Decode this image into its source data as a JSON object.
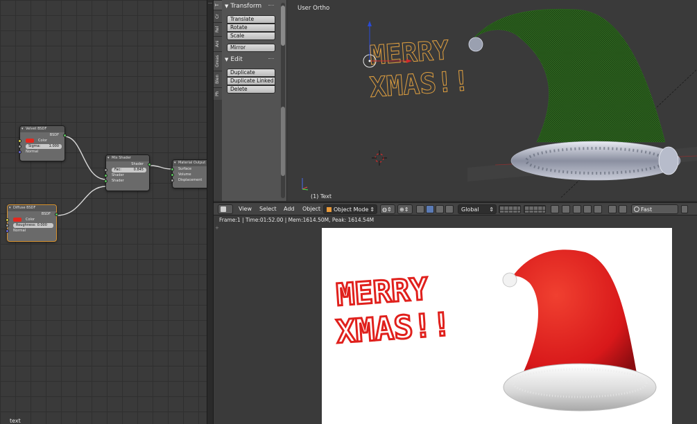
{
  "node_editor": {
    "status_text": "text",
    "nodes": {
      "velvet": {
        "title": "Velvet BSDF",
        "output": "BSDF",
        "color_label": "Color",
        "sigma_label": "Sigma:",
        "sigma_value": "1.000",
        "normal_label": "Normal"
      },
      "diffuse": {
        "title": "Diffuse BSDF",
        "output": "BSDF",
        "color_label": "Color",
        "roughness_label": "Roughness:",
        "roughness_value": "0.000",
        "normal_label": "Normal"
      },
      "mix": {
        "title": "Mix Shader",
        "output": "Shader",
        "fac_label": "Fac:",
        "fac_value": "0.845",
        "shader1": "Shader",
        "shader2": "Shader"
      },
      "output": {
        "title": "Material Output",
        "surface": "Surface",
        "volume": "Volume",
        "displacement": "Displacement"
      }
    },
    "colors": {
      "swatch": "#e3281e",
      "socket_shader": "#58c35a",
      "socket_color": "#d8d24a",
      "socket_value": "#9a9a9a",
      "socket_vector": "#6a6ad8",
      "selected_border": "#d8912c"
    }
  },
  "tool_shelf": {
    "tabs": [
      "T",
      "Cr",
      "Rel",
      "Ani",
      "Greas",
      "Blen",
      "Ph"
    ],
    "transform": {
      "title": "Transform",
      "buttons": [
        "Translate",
        "Rotate",
        "Scale",
        "Mirror"
      ]
    },
    "edit": {
      "title": "Edit",
      "buttons": [
        "Duplicate",
        "Duplicate Linked",
        "Delete"
      ]
    }
  },
  "viewport": {
    "title": "User Ortho",
    "active_object": "(1) Text",
    "scene_text_line1": "MERRY",
    "scene_text_line2": "XMAS!!",
    "hat_color": "#2d5a1e",
    "text_outline_color": "#e0a040"
  },
  "header": {
    "menus": [
      "View",
      "Select",
      "Add",
      "Object"
    ],
    "mode": "Object Mode",
    "orientation": "Global",
    "render_preset": "Fast Preview"
  },
  "render": {
    "info": "Frame:1 | Time:01:52.00 | Mem:1614.50M, Peak: 1614.54M",
    "text_line1": "MERRY",
    "text_line2": "XMAS!!",
    "hat_color": "#e0201c",
    "text_color": "#e0201c"
  }
}
